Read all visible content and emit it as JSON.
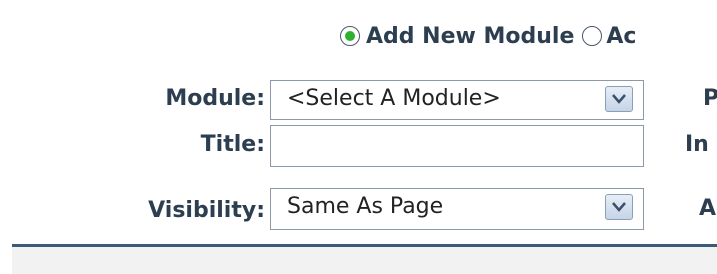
{
  "mode": {
    "add_new": "Add New Module",
    "add_existing": "Ac"
  },
  "form": {
    "module_label": "Module:",
    "module_value": "<Select A Module>",
    "title_label": "Title:",
    "title_value": "",
    "visibility_label": "Visibility:",
    "visibility_value": "Same As Page"
  },
  "right_column": {
    "row1": "P",
    "row2": "In",
    "row3": "A"
  },
  "colors": {
    "radio_selected": "#2fb12f",
    "divider": "#3b5a78"
  }
}
